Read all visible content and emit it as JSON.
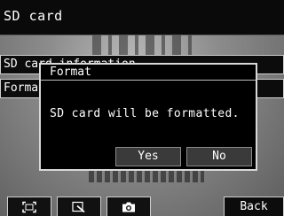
{
  "header": {
    "title": "SD card"
  },
  "menu": {
    "items": [
      {
        "label": "SD card information"
      },
      {
        "label": "Format"
      }
    ]
  },
  "dialog": {
    "title": "Format",
    "message": "SD card will be formatted.",
    "yes_label": "Yes",
    "no_label": "No"
  },
  "toolbar": {
    "buttons": [
      {
        "icon": "frame-icon"
      },
      {
        "icon": "zoom-icon"
      },
      {
        "icon": "camera-icon"
      }
    ],
    "back_label": "Back"
  },
  "colors": {
    "background": "#000000",
    "border": "#cfcfcf",
    "button_fill": "#3a3a3a"
  }
}
